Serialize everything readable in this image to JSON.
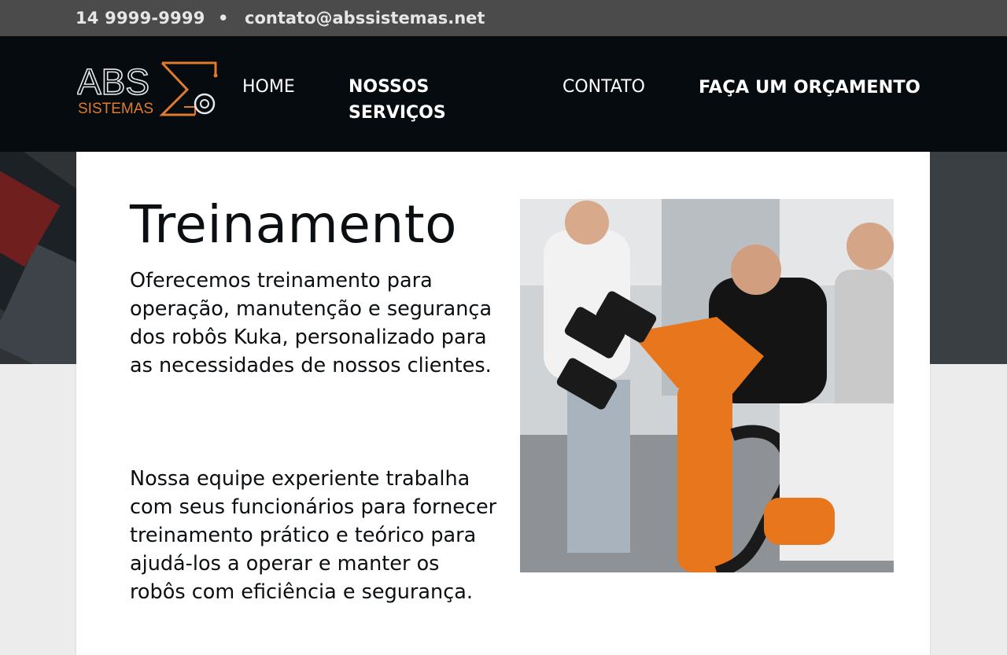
{
  "topbar": {
    "phone": "14 9999-9999",
    "separator": "•",
    "email": "contato@abssistemas.net"
  },
  "logo": {
    "text_main": "ABS",
    "text_sub": "SISTEMAS",
    "accent_color": "#e07a2e"
  },
  "nav": {
    "home": "HOME",
    "services": "NOSSOS SERVIÇOS",
    "contact": "CONTATO",
    "quote": "FAÇA UM ORÇAMENTO"
  },
  "main": {
    "title": "Treinamento",
    "paragraph1": "Oferecemos treinamento para operação, manutenção e segurança dos robôs Kuka, personalizado para as necessidades de nossos clientes.",
    "paragraph2": "Nossa equipe experiente trabalha com seus funcionários para fornecer treinamento prático e teórico para ajudá-los a operar e manter os robôs com eficiência e segurança."
  },
  "colors": {
    "topbar_bg": "#4b4b4b",
    "nav_bg": "#050b0f",
    "robot_orange": "#e8761c"
  }
}
